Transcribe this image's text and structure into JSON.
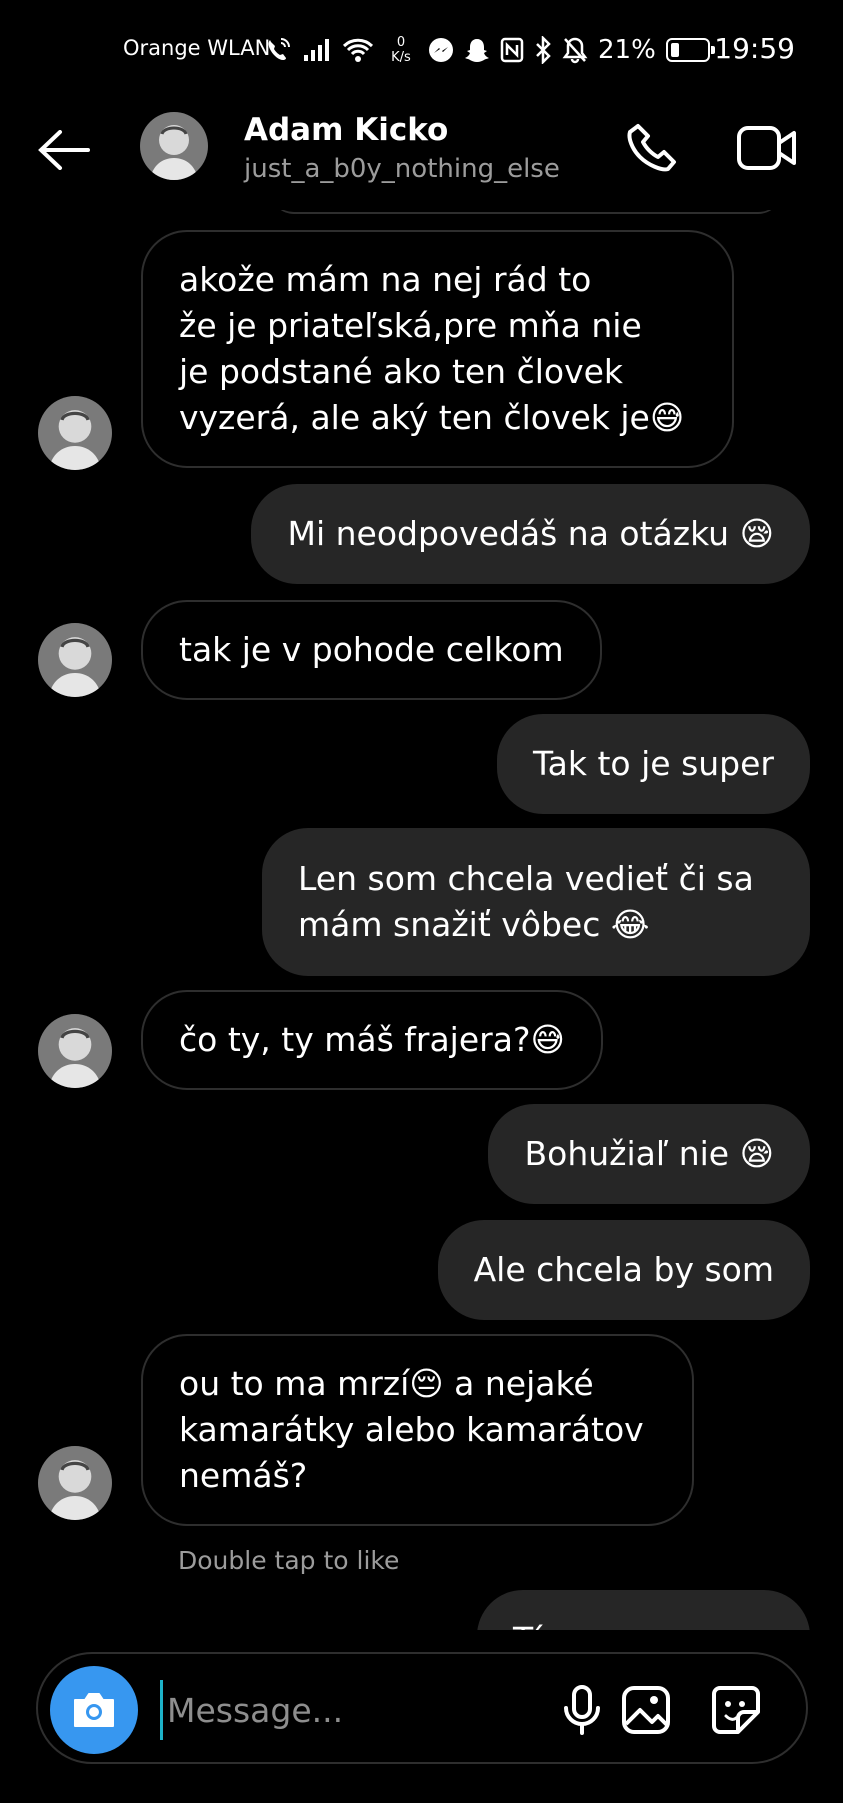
{
  "status_bar": {
    "carrier": "Orange WLAN",
    "net_speed_value": "0",
    "net_speed_unit": "K/s",
    "battery_percent": "21%",
    "battery_level": 0.21,
    "time": "19:59"
  },
  "header": {
    "name": "Adam Kicko",
    "username": "just_a_b0y_nothing_else"
  },
  "messages": [
    {
      "from": "them",
      "text": "akože mám na nej rád to\nže je priateľská,pre mňa nie\nje podstané ako ten človek\nvyzerá, ale aký ten človek je😅"
    },
    {
      "from": "me",
      "text": "Mi neodpovedáš na otázku 😪"
    },
    {
      "from": "them",
      "text": "tak je v pohode celkom"
    },
    {
      "from": "me",
      "text": "Tak to je super"
    },
    {
      "from": "me",
      "text": "Len som chcela vedieť či sa\nmám snažiť vôbec 😂"
    },
    {
      "from": "them",
      "text": "čo ty, ty máš frajera?😅"
    },
    {
      "from": "me",
      "text": "Bohužiaľ nie 😪"
    },
    {
      "from": "me",
      "text": "Ale chcela by som"
    },
    {
      "from": "them",
      "text": "ou to ma mrzí😔 a nejaké\nkamarátky alebo kamarátov\nnemáš?"
    },
    {
      "from": "me",
      "text": "Tá ..."
    }
  ],
  "double_tap_hint": "Double tap to like",
  "composer": {
    "placeholder": "Message..."
  },
  "icons": {
    "back": "arrow-left-icon",
    "call": "phone-icon",
    "video": "video-camera-icon",
    "camera": "camera-icon",
    "mic": "microphone-icon",
    "gallery": "image-icon",
    "sticker": "sticker-icon"
  },
  "colors": {
    "background": "#000000",
    "outgoing_bubble": "#262626",
    "incoming_border": "#2e2e2e",
    "camera_button": "#3797f0",
    "secondary_text": "#9c9c9c"
  }
}
